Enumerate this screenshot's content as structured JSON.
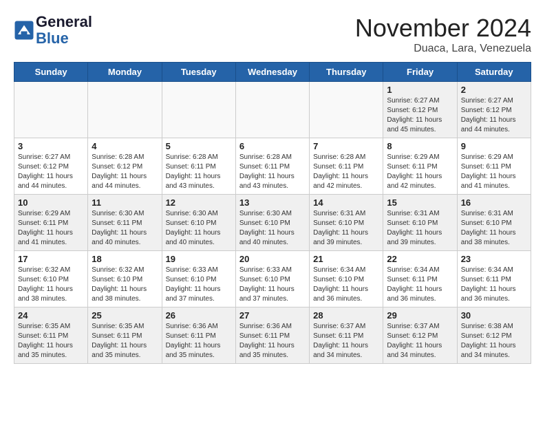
{
  "header": {
    "logo_line1": "General",
    "logo_line2": "Blue",
    "month_title": "November 2024",
    "location": "Duaca, Lara, Venezuela"
  },
  "weekdays": [
    "Sunday",
    "Monday",
    "Tuesday",
    "Wednesday",
    "Thursday",
    "Friday",
    "Saturday"
  ],
  "weeks": [
    [
      {
        "day": "",
        "info": ""
      },
      {
        "day": "",
        "info": ""
      },
      {
        "day": "",
        "info": ""
      },
      {
        "day": "",
        "info": ""
      },
      {
        "day": "",
        "info": ""
      },
      {
        "day": "1",
        "info": "Sunrise: 6:27 AM\nSunset: 6:12 PM\nDaylight: 11 hours and 45 minutes."
      },
      {
        "day": "2",
        "info": "Sunrise: 6:27 AM\nSunset: 6:12 PM\nDaylight: 11 hours and 44 minutes."
      }
    ],
    [
      {
        "day": "3",
        "info": "Sunrise: 6:27 AM\nSunset: 6:12 PM\nDaylight: 11 hours and 44 minutes."
      },
      {
        "day": "4",
        "info": "Sunrise: 6:28 AM\nSunset: 6:12 PM\nDaylight: 11 hours and 44 minutes."
      },
      {
        "day": "5",
        "info": "Sunrise: 6:28 AM\nSunset: 6:11 PM\nDaylight: 11 hours and 43 minutes."
      },
      {
        "day": "6",
        "info": "Sunrise: 6:28 AM\nSunset: 6:11 PM\nDaylight: 11 hours and 43 minutes."
      },
      {
        "day": "7",
        "info": "Sunrise: 6:28 AM\nSunset: 6:11 PM\nDaylight: 11 hours and 42 minutes."
      },
      {
        "day": "8",
        "info": "Sunrise: 6:29 AM\nSunset: 6:11 PM\nDaylight: 11 hours and 42 minutes."
      },
      {
        "day": "9",
        "info": "Sunrise: 6:29 AM\nSunset: 6:11 PM\nDaylight: 11 hours and 41 minutes."
      }
    ],
    [
      {
        "day": "10",
        "info": "Sunrise: 6:29 AM\nSunset: 6:11 PM\nDaylight: 11 hours and 41 minutes."
      },
      {
        "day": "11",
        "info": "Sunrise: 6:30 AM\nSunset: 6:11 PM\nDaylight: 11 hours and 40 minutes."
      },
      {
        "day": "12",
        "info": "Sunrise: 6:30 AM\nSunset: 6:10 PM\nDaylight: 11 hours and 40 minutes."
      },
      {
        "day": "13",
        "info": "Sunrise: 6:30 AM\nSunset: 6:10 PM\nDaylight: 11 hours and 40 minutes."
      },
      {
        "day": "14",
        "info": "Sunrise: 6:31 AM\nSunset: 6:10 PM\nDaylight: 11 hours and 39 minutes."
      },
      {
        "day": "15",
        "info": "Sunrise: 6:31 AM\nSunset: 6:10 PM\nDaylight: 11 hours and 39 minutes."
      },
      {
        "day": "16",
        "info": "Sunrise: 6:31 AM\nSunset: 6:10 PM\nDaylight: 11 hours and 38 minutes."
      }
    ],
    [
      {
        "day": "17",
        "info": "Sunrise: 6:32 AM\nSunset: 6:10 PM\nDaylight: 11 hours and 38 minutes."
      },
      {
        "day": "18",
        "info": "Sunrise: 6:32 AM\nSunset: 6:10 PM\nDaylight: 11 hours and 38 minutes."
      },
      {
        "day": "19",
        "info": "Sunrise: 6:33 AM\nSunset: 6:10 PM\nDaylight: 11 hours and 37 minutes."
      },
      {
        "day": "20",
        "info": "Sunrise: 6:33 AM\nSunset: 6:10 PM\nDaylight: 11 hours and 37 minutes."
      },
      {
        "day": "21",
        "info": "Sunrise: 6:34 AM\nSunset: 6:10 PM\nDaylight: 11 hours and 36 minutes."
      },
      {
        "day": "22",
        "info": "Sunrise: 6:34 AM\nSunset: 6:11 PM\nDaylight: 11 hours and 36 minutes."
      },
      {
        "day": "23",
        "info": "Sunrise: 6:34 AM\nSunset: 6:11 PM\nDaylight: 11 hours and 36 minutes."
      }
    ],
    [
      {
        "day": "24",
        "info": "Sunrise: 6:35 AM\nSunset: 6:11 PM\nDaylight: 11 hours and 35 minutes."
      },
      {
        "day": "25",
        "info": "Sunrise: 6:35 AM\nSunset: 6:11 PM\nDaylight: 11 hours and 35 minutes."
      },
      {
        "day": "26",
        "info": "Sunrise: 6:36 AM\nSunset: 6:11 PM\nDaylight: 11 hours and 35 minutes."
      },
      {
        "day": "27",
        "info": "Sunrise: 6:36 AM\nSunset: 6:11 PM\nDaylight: 11 hours and 35 minutes."
      },
      {
        "day": "28",
        "info": "Sunrise: 6:37 AM\nSunset: 6:11 PM\nDaylight: 11 hours and 34 minutes."
      },
      {
        "day": "29",
        "info": "Sunrise: 6:37 AM\nSunset: 6:12 PM\nDaylight: 11 hours and 34 minutes."
      },
      {
        "day": "30",
        "info": "Sunrise: 6:38 AM\nSunset: 6:12 PM\nDaylight: 11 hours and 34 minutes."
      }
    ]
  ]
}
